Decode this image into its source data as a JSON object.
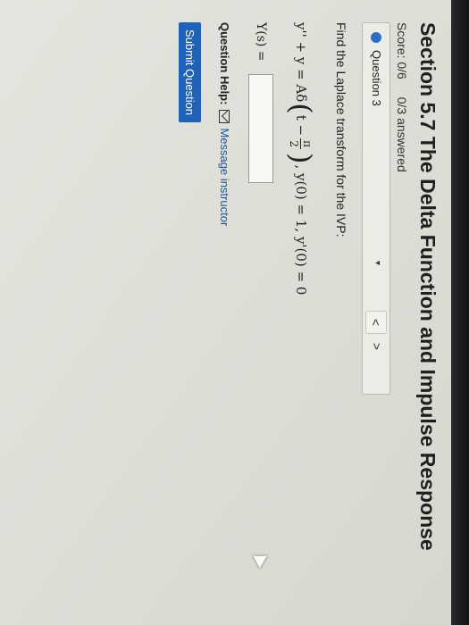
{
  "section_title": "Section 5.7 The Delta Function and Impulse Response",
  "score": "Score: 0/6",
  "answered": "0/3 answered",
  "question_label": "Question 3",
  "nav": {
    "dropdown": "▾",
    "prev": "<",
    "next": ">"
  },
  "prompt": "Find the Laplace transform for the IVP:",
  "equation": {
    "lhs": "y'' + y = Aδ",
    "inner_start": "t −",
    "frac_num": "π",
    "frac_den": "2",
    "conditions": ", y(0) = 1, y'(0) = 0"
  },
  "ys_label": "Y(s) =",
  "answer_value": "",
  "help": {
    "label": "Question Help:",
    "link": "Message instructor"
  },
  "submit_label": "Submit Question"
}
